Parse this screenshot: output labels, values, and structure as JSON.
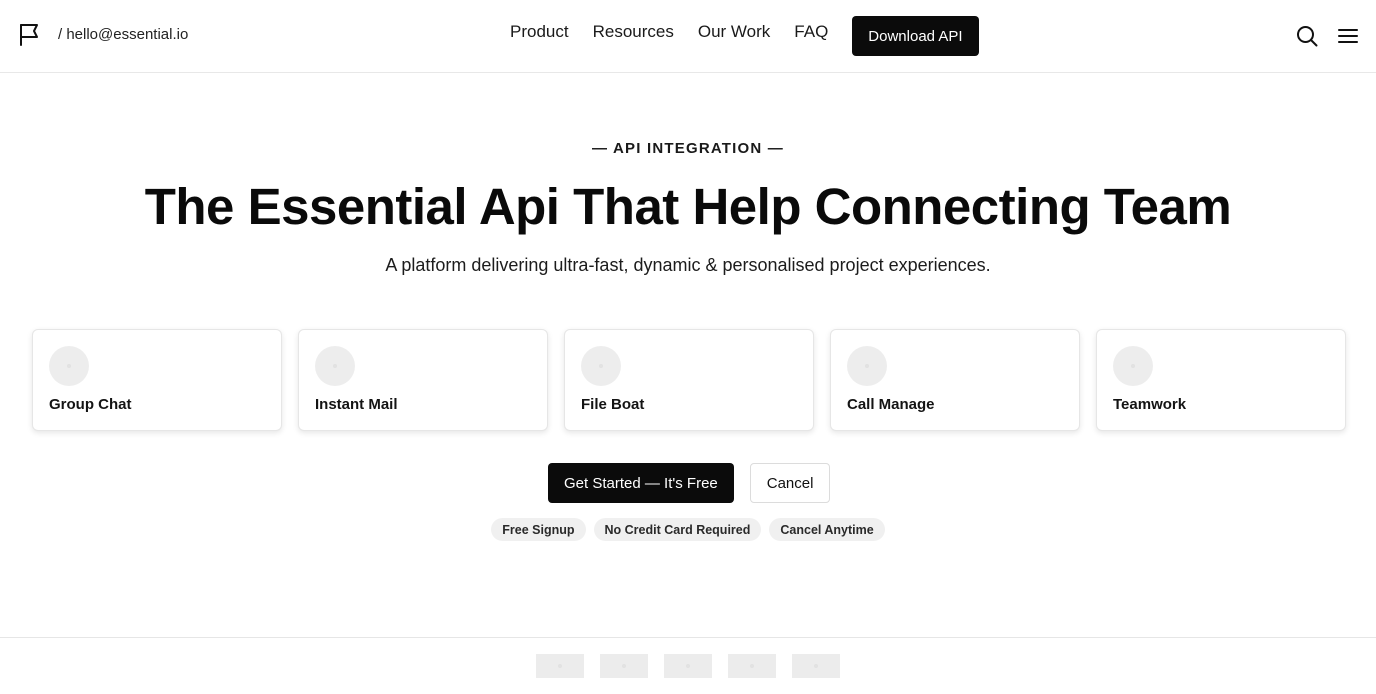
{
  "header": {
    "email": "/ hello@essential.io",
    "nav": [
      {
        "label": "Product"
      },
      {
        "label": "Resources"
      },
      {
        "label": "Our Work"
      },
      {
        "label": "FAQ"
      }
    ],
    "download_label": "Download API",
    "icons": {
      "brand": "flag-icon",
      "search": "search-icon",
      "menu": "hamburger-menu-icon"
    }
  },
  "hero": {
    "eyebrow": "— API INTEGRATION —",
    "title": "The Essential Api That Help Connecting Team",
    "subtitle": "A platform delivering ultra-fast, dynamic & personalised project experiences."
  },
  "cards": [
    {
      "label": "Group Chat"
    },
    {
      "label": "Instant Mail"
    },
    {
      "label": "File Boat"
    },
    {
      "label": "Call Manage"
    },
    {
      "label": "Teamwork"
    }
  ],
  "cta": {
    "primary": "Get Started — It's Free",
    "secondary": "Cancel"
  },
  "badges": [
    "Free Signup",
    "No Credit Card Required",
    "Cancel Anytime"
  ],
  "colors": {
    "primary": "#0b0b0b",
    "background": "#ffffff",
    "badge_bg": "#f0f0f0",
    "placeholder": "#ededed"
  }
}
